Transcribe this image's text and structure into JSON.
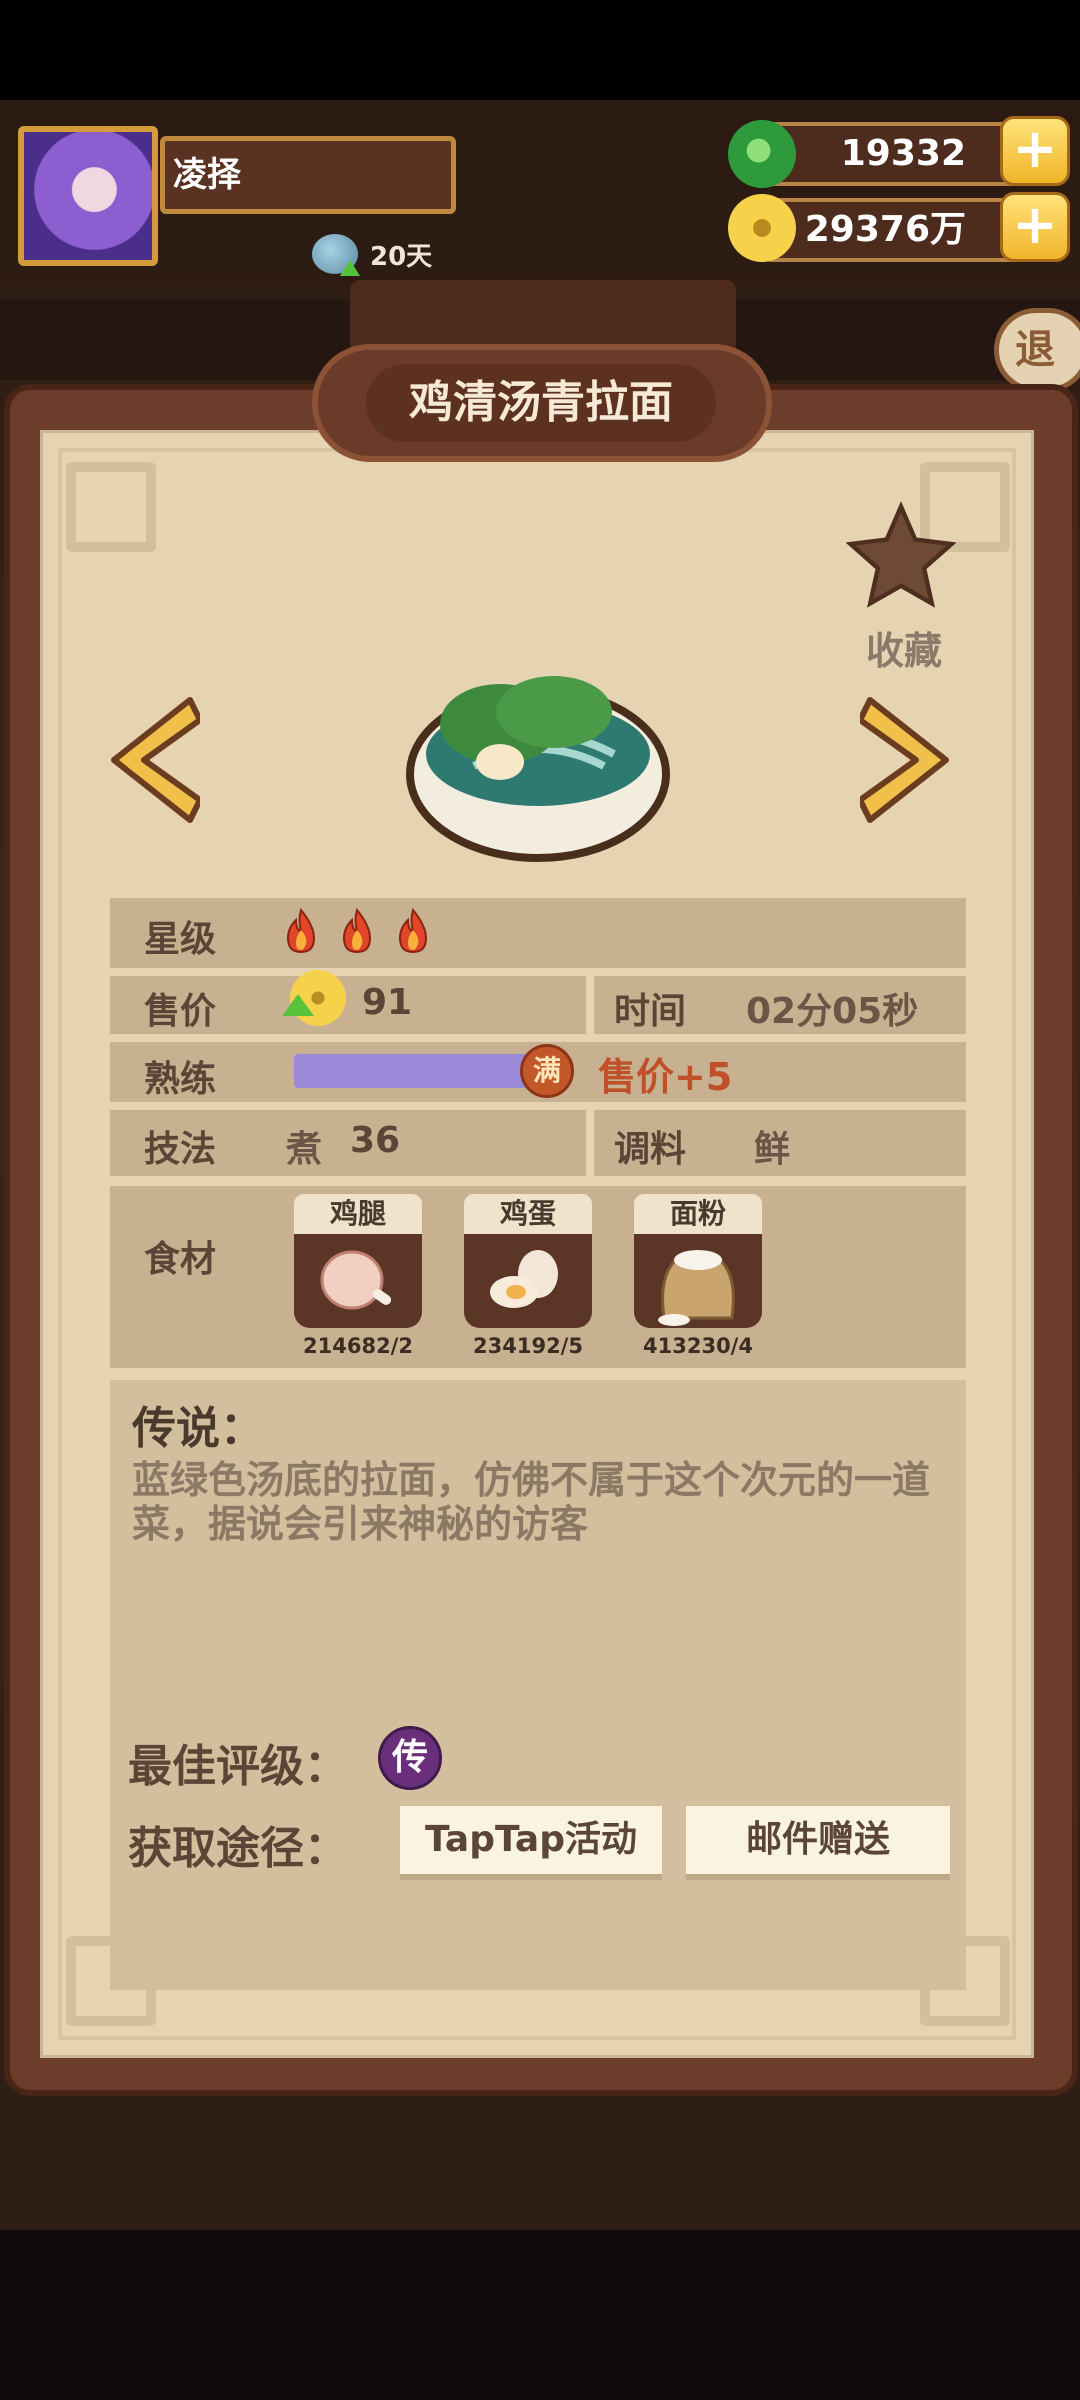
{
  "player": {
    "name": "凌择",
    "days": "20天"
  },
  "currency": {
    "jade": "19332",
    "coins": "29376万"
  },
  "exit_label": "退",
  "dish": {
    "name": "鸡清汤青拉面",
    "favorite_label": "收藏"
  },
  "stats": {
    "star_label": "星级",
    "star_count": 3,
    "price_label": "售价",
    "price_value": "91",
    "time_label": "时间",
    "time_value": "02分05秒",
    "proficiency_label": "熟练",
    "proficiency_fraction": 1.0,
    "proficiency_max": "满",
    "proficiency_bonus": "售价+5",
    "technique_label": "技法",
    "technique_name": "煮",
    "technique_value": "36",
    "seasoning_label": "调料",
    "seasoning_value": "鲜",
    "ingredients_label": "食材",
    "ingredients": [
      {
        "name": "鸡腿",
        "count": "214682/2"
      },
      {
        "name": "鸡蛋",
        "count": "234192/5"
      },
      {
        "name": "面粉",
        "count": "413230/4"
      }
    ]
  },
  "legend": {
    "title": "传说：",
    "text": "蓝绿色汤底的拉面，仿佛不属于这个次元的一道菜，据说会引来神秘的访客"
  },
  "best_rating": {
    "label": "最佳评级：",
    "badge": "传"
  },
  "sources": {
    "label": "获取途径：",
    "items": [
      "TapTap活动",
      "邮件赠送"
    ]
  },
  "colors": {
    "panel": "#e5d3b2",
    "row": "#c8b190",
    "frame": "#6b3d2a",
    "accent": "#c0502a",
    "bar": "#9a8ad8"
  }
}
